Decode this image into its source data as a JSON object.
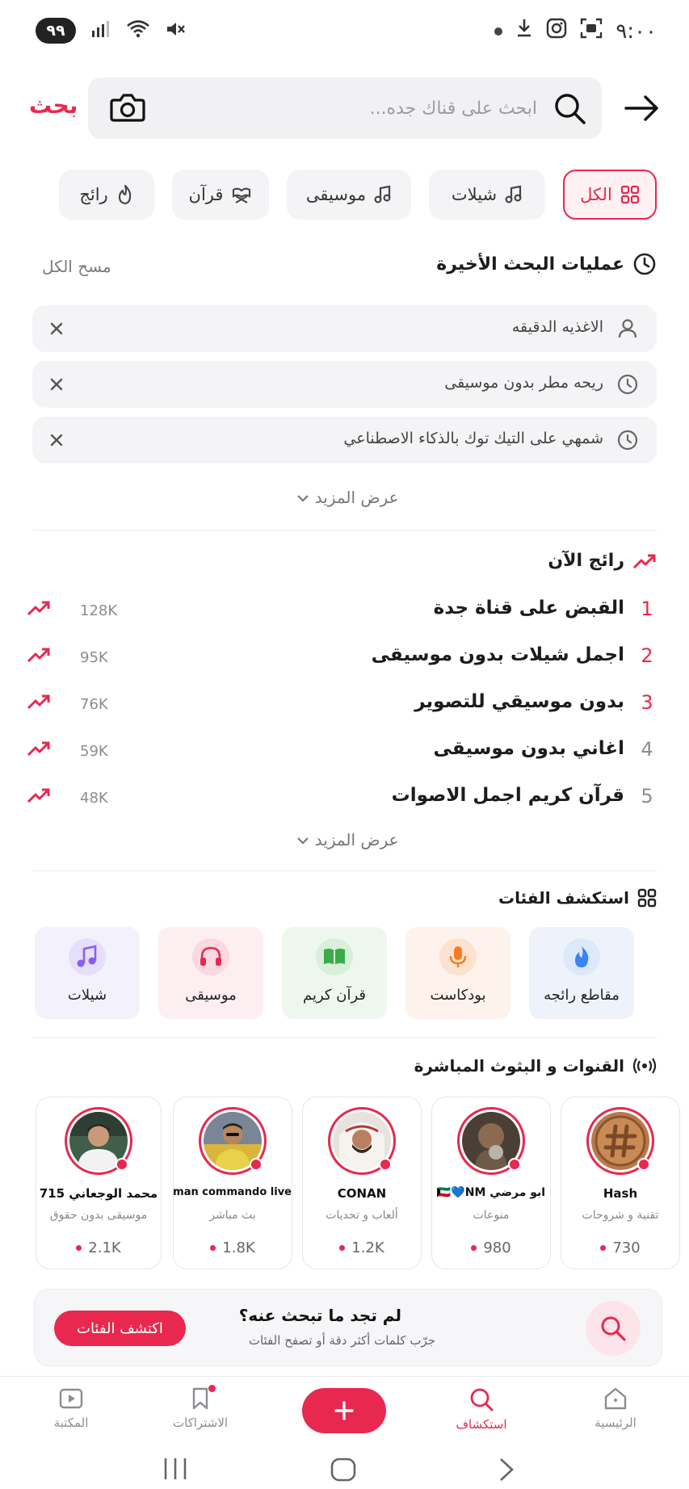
{
  "status_bar": {
    "time": "٩:٠٠",
    "battery": "٩٩",
    "icons": [
      "dot-icon",
      "download-icon",
      "instagram-icon",
      "screenshot-icon",
      "mute-icon",
      "wifi-icon",
      "signal-icon"
    ]
  },
  "header": {
    "search_placeholder": "ابحث على قناك جده...",
    "search_label": "بحث"
  },
  "chips": [
    {
      "label": "الكل",
      "icon": "grid-icon",
      "active": true
    },
    {
      "label": "شيلات",
      "icon": "music-note-icon",
      "active": false
    },
    {
      "label": "موسيقى",
      "icon": "music-note-icon",
      "active": false
    },
    {
      "label": "قرآن",
      "icon": "quran-stand-icon",
      "active": false
    },
    {
      "label": "رائج",
      "icon": "flame-icon",
      "active": false
    }
  ],
  "recent": {
    "title": "عمليات البحث الأخيرة",
    "clear_all": "مسح الكل",
    "items": [
      {
        "text": "الاغذيه الدقيقه",
        "icon": "user-icon"
      },
      {
        "text": "ريحه مطر بدون موسيقى",
        "icon": "clock-icon"
      },
      {
        "text": "شمهي على التيك توك بالذكاء الاصطناعي",
        "icon": "clock-icon"
      }
    ],
    "show_more": "عرض المزيد"
  },
  "trending": {
    "title": "رائج الآن",
    "items": [
      {
        "rank": "1",
        "text": "القبض على قناة جدة",
        "count": "128K"
      },
      {
        "rank": "2",
        "text": "اجمل شيلات بدون موسيقى",
        "count": "95K"
      },
      {
        "rank": "3",
        "text": "بدون موسيقي للتصوير",
        "count": "76K"
      },
      {
        "rank": "4",
        "text": "اغاني بدون موسيقى",
        "count": "59K"
      },
      {
        "rank": "5",
        "text": "قرآن كريم اجمل الاصوات",
        "count": "48K"
      }
    ],
    "show_more": "عرض المزيد"
  },
  "categories": {
    "title": "استكشف الفئات",
    "items": [
      {
        "label": "مقاطع رائجه",
        "icon": "flame-icon",
        "bg": "#eef3fb",
        "accent": "#3b82f6"
      },
      {
        "label": "بودكاست",
        "icon": "microphone-icon",
        "bg": "#fdf3ec",
        "accent": "#f47c20"
      },
      {
        "label": "قرآن كريم",
        "icon": "book-icon",
        "bg": "#eef7ee",
        "accent": "#3caa4a"
      },
      {
        "label": "موسيقى",
        "icon": "headphones-icon",
        "bg": "#fdeef1",
        "accent": "#e8284f"
      },
      {
        "label": "شيلات",
        "icon": "music-note-icon",
        "bg": "#f3f1fb",
        "accent": "#8b5cf6"
      }
    ]
  },
  "live": {
    "title": "القنوات و البثوث المباشرة",
    "channels": [
      {
        "name": "محمد الوجعاني 715",
        "category": "موسيقى بدون حقوق",
        "views": "2.1K"
      },
      {
        "name": "Salman commando live",
        "category": "بث مباشر",
        "views": "1.8K"
      },
      {
        "name": "CONAN",
        "category": "ألعاب و تحديات",
        "views": "1.2K"
      },
      {
        "name": "ابو مرضي 🇰🇼💙NM",
        "category": "منوعات",
        "views": "980"
      },
      {
        "name": "Hash",
        "category": "تقنية و شروحات",
        "views": "730"
      }
    ]
  },
  "cta": {
    "title": "لم تجد ما تبحث عنه؟",
    "subtitle": "جرّب كلمات أكثر دقة أو تصفح الفئات",
    "button": "اكتشف الفئات"
  },
  "bottom_nav": {
    "items": [
      {
        "label": "المكتبة",
        "icon": "play-box-icon"
      },
      {
        "label": "الاشتراكات",
        "icon": "bookmark-icon"
      },
      {
        "label": "استكشاف",
        "icon": "search-icon"
      },
      {
        "label": "الرئيسية",
        "icon": "home-icon"
      }
    ]
  },
  "colors": {
    "accent": "#e8284f",
    "surface": "#f4f4f6",
    "text": "#1c1c1e",
    "muted": "#8c8c92"
  }
}
